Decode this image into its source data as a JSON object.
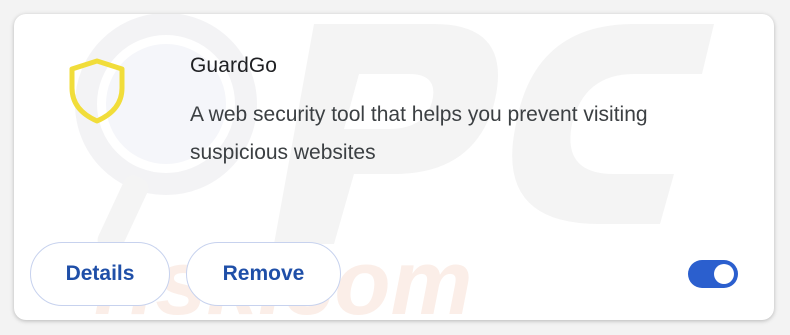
{
  "extension": {
    "name": "GuardGo",
    "description": "A web security tool that helps you prevent visiting suspicious websites",
    "icon": "shield-icon",
    "icon_color": "#f1dd3a"
  },
  "actions": {
    "details_label": "Details",
    "remove_label": "Remove"
  },
  "toggle": {
    "enabled": true,
    "color": "#2b5fce"
  },
  "watermark": {
    "text": "risk.com",
    "logo": "PC"
  }
}
